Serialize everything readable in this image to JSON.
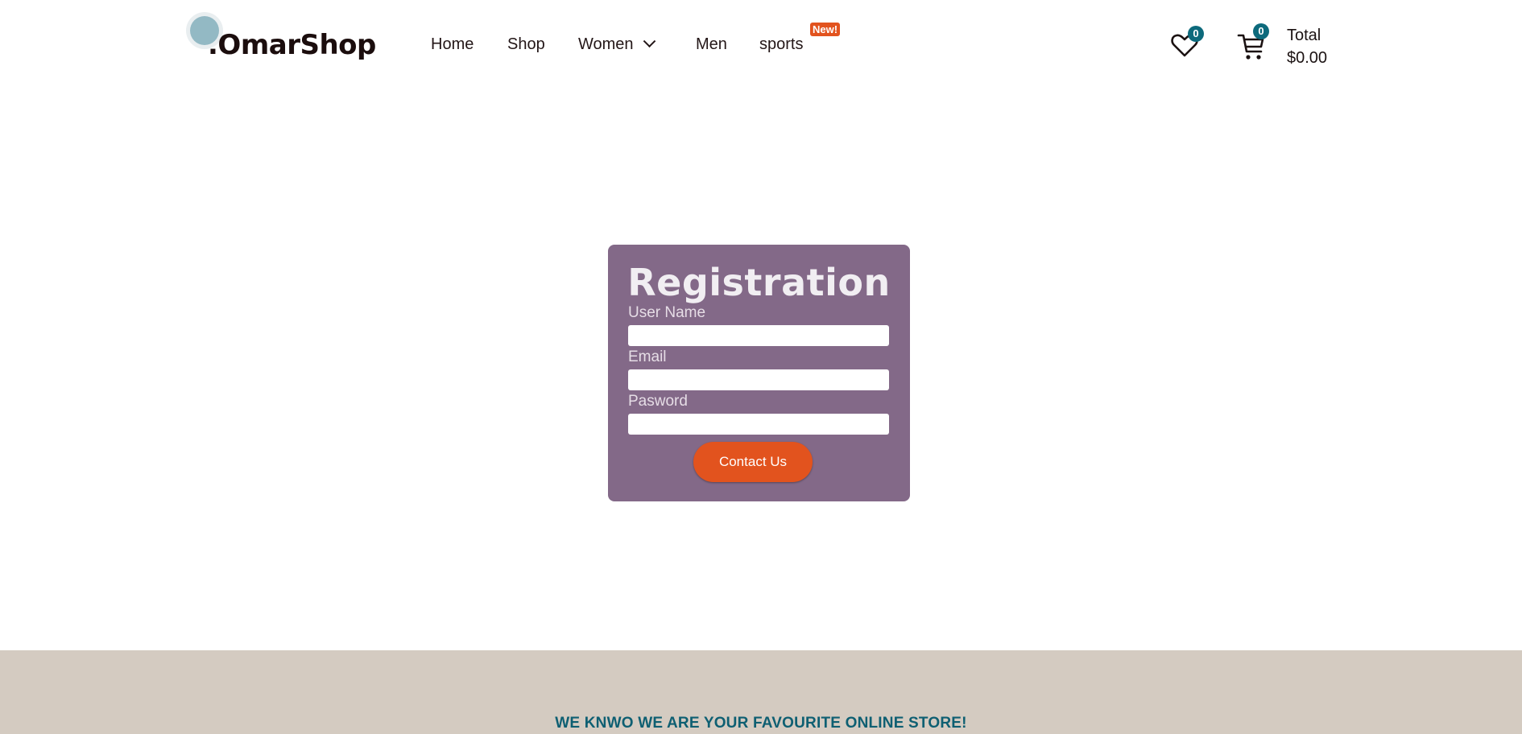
{
  "brand": {
    "logo_text": ".OmarShop"
  },
  "nav": {
    "items": [
      "Home",
      "Shop",
      "Women",
      "Men",
      "sports"
    ],
    "new_badge": "New!"
  },
  "header_actions": {
    "wishlist_count": "0",
    "cart_count": "0",
    "total_label": "Total",
    "total_value": "$0.00"
  },
  "form": {
    "title": "Registration",
    "username_label": "User Name",
    "email_label": "Email",
    "password_label": "Pasword",
    "username_value": "",
    "email_value": "",
    "password_value": "",
    "submit_label": "Contact Us"
  },
  "footer": {
    "tagline": "WE KNWO WE ARE YOUR FAVOURITE ONLINE STORE!"
  },
  "colors": {
    "accent": "#e2531e",
    "card": "#836988",
    "badge": "#0d6a7c",
    "footer_bg": "#d4cbc1",
    "footer_text": "#0e5f72"
  }
}
